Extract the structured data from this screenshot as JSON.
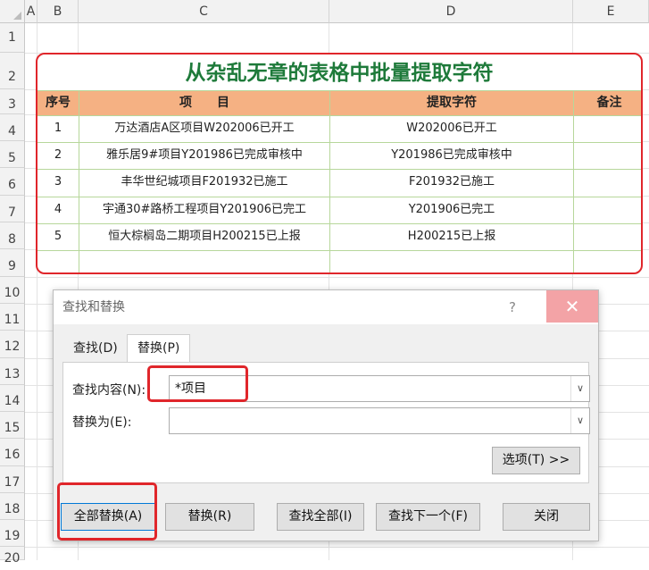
{
  "sheet": {
    "columns": [
      "A",
      "B",
      "C",
      "D",
      "E"
    ],
    "rows": [
      "1",
      "2",
      "3",
      "4",
      "5",
      "6",
      "7",
      "8",
      "9",
      "10",
      "11",
      "12",
      "13",
      "14",
      "15",
      "16",
      "17",
      "18",
      "19",
      "20"
    ]
  },
  "table": {
    "title": "从杂乱无章的表格中批量提取字符",
    "headers": {
      "seq": "序号",
      "item": "项　　目",
      "extract": "提取字符",
      "note": "备注"
    },
    "rows": [
      {
        "seq": "1",
        "item": "万达酒店A区项目W202006已开工",
        "extract": "W202006已开工",
        "note": ""
      },
      {
        "seq": "2",
        "item": "雅乐居9#项目Y201986已完成审核中",
        "extract": "Y201986已完成审核中",
        "note": ""
      },
      {
        "seq": "3",
        "item": "丰华世纪城项目F201932已施工",
        "extract": "F201932已施工",
        "note": ""
      },
      {
        "seq": "4",
        "item": "宇通30#路桥工程项目Y201906已完工",
        "extract": "Y201906已完工",
        "note": ""
      },
      {
        "seq": "5",
        "item": "恒大棕榈岛二期项目H200215已上报",
        "extract": "H200215已上报",
        "note": ""
      },
      {
        "seq": "",
        "item": "",
        "extract": "",
        "note": ""
      }
    ],
    "colors": {
      "title": "#1e7a3a",
      "header_bg": "#f5b183",
      "border": "#e0262b",
      "grid": "#b7d79b"
    }
  },
  "dialog": {
    "title": "查找和替换",
    "help_label": "?",
    "close_label": "✕",
    "tabs": [
      {
        "label": "查找(D)",
        "active": false
      },
      {
        "label": "替换(P)",
        "active": true
      }
    ],
    "find": {
      "label": "查找内容(N):",
      "value": "*项目"
    },
    "replace": {
      "label": "替换为(E):",
      "value": ""
    },
    "options_label": "选项(T) >>",
    "buttons": {
      "replace_all": "全部替换(A)",
      "replace": "替换(R)",
      "find_all": "查找全部(I)",
      "find_next": "查找下一个(F)",
      "close": "关闭"
    },
    "highlight_color": "#e0262b"
  }
}
